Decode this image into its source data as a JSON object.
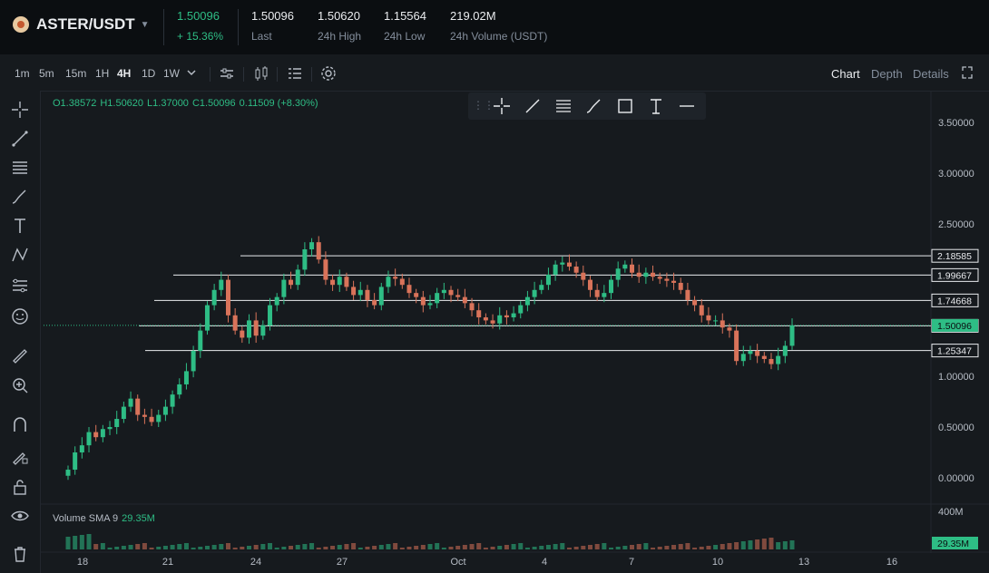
{
  "header": {
    "pair": "ASTER/USDT",
    "price": "1.50096",
    "change": "+ 15.36%",
    "stats": [
      {
        "value": "1.50096",
        "label": "Last"
      },
      {
        "value": "1.50620",
        "label": "24h High"
      },
      {
        "value": "1.15564",
        "label": "24h Low"
      },
      {
        "value": "219.02M",
        "label": "24h Volume (USDT)"
      }
    ]
  },
  "toolbar": {
    "timeframes": [
      "1m",
      "5m",
      "15m",
      "1H",
      "4H",
      "1D",
      "1W"
    ],
    "active_timeframe": "4H",
    "views": [
      "Chart",
      "Depth",
      "Details"
    ],
    "active_view": "Chart"
  },
  "ohlc": {
    "open": "O1.38572",
    "high": "H1.50620",
    "low": "L1.37000",
    "close": "C1.50096",
    "change": "0.11509 (+8.30%)"
  },
  "volume": {
    "label": "Volume SMA 9",
    "value": "29.35M",
    "axis_top": "400M",
    "axis_badge": "29.35M"
  },
  "chart_data": {
    "type": "candlestick",
    "y_ticks": [
      "3.50000",
      "3.00000",
      "2.50000",
      "2.00000",
      "1.50000",
      "1.00000",
      "0.50000",
      "0.00000"
    ],
    "x_ticks": [
      "18",
      "21",
      "24",
      "27",
      "Oct",
      "4",
      "7",
      "10",
      "13",
      "16"
    ],
    "horizontal_levels": [
      "2.18585",
      "1.99667",
      "1.74668",
      "1.49670",
      "1.25347"
    ],
    "last_price": "1.50096",
    "colors": {
      "up": "#2ebd85",
      "down": "#f6465d",
      "down_soft": "#d9735a",
      "level": "#eaecef"
    },
    "closes": [
      0.08,
      0.25,
      0.32,
      0.45,
      0.4,
      0.48,
      0.5,
      0.58,
      0.7,
      0.78,
      0.62,
      0.6,
      0.55,
      0.62,
      0.7,
      0.82,
      0.92,
      1.05,
      1.25,
      1.45,
      1.7,
      1.85,
      1.95,
      1.6,
      1.45,
      1.38,
      1.55,
      1.4,
      1.5,
      1.7,
      1.78,
      1.95,
      1.9,
      2.05,
      2.25,
      2.32,
      2.15,
      1.95,
      1.9,
      1.98,
      1.88,
      1.8,
      1.85,
      1.75,
      1.7,
      1.88,
      1.98,
      1.96,
      1.9,
      1.82,
      1.78,
      1.7,
      1.72,
      1.82,
      1.85,
      1.8,
      1.78,
      1.72,
      1.65,
      1.58,
      1.55,
      1.52,
      1.6,
      1.58,
      1.62,
      1.7,
      1.78,
      1.85,
      1.9,
      2.0,
      2.1,
      2.12,
      2.08,
      2.02,
      1.95,
      1.85,
      1.78,
      1.82,
      1.95,
      2.06,
      2.1,
      2.02,
      1.98,
      2.02,
      1.98,
      1.96,
      1.94,
      1.92,
      1.85,
      1.75,
      1.7,
      1.6,
      1.55,
      1.55,
      1.48,
      1.45,
      1.15,
      1.22,
      1.25,
      1.2,
      1.17,
      1.12,
      1.2,
      1.3,
      1.5
    ]
  }
}
